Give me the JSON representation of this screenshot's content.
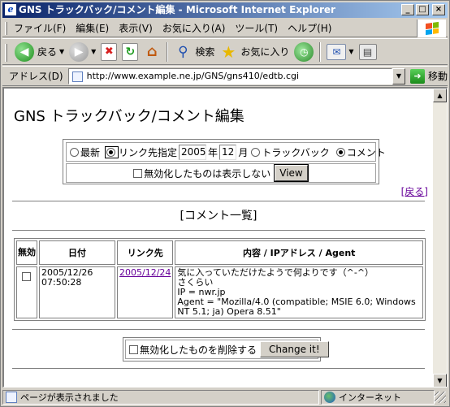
{
  "window": {
    "title": "GNS トラックバック/コメント編集 - Microsoft Internet Explorer",
    "minimize": "_",
    "maximize": "□",
    "close": "×"
  },
  "menubar": {
    "items": [
      "ファイル(F)",
      "編集(E)",
      "表示(V)",
      "お気に入り(A)",
      "ツール(T)",
      "ヘルプ(H)"
    ]
  },
  "toolbar": {
    "back_label": "戻る",
    "search_label": "検索",
    "favorites_label": "お気に入り"
  },
  "address": {
    "label": "アドレス(D)",
    "url": "http://www.example.ne.jp/GNS/gns410/edtb.cgi",
    "go_label": "移動"
  },
  "page": {
    "title": "GNS トラックバック/コメント編集",
    "filter": {
      "radio_latest": "最新",
      "radio_link_date": "リンク先指定",
      "year_value": "2005",
      "year_unit": "年",
      "month_value": "12",
      "month_unit": "月",
      "radio_trackback": "トラックバック",
      "radio_comment": "コメント",
      "hide_disabled_label": "無効化したものは表示しない",
      "view_button": "View"
    },
    "back_link": "[戻る]",
    "section_heading": "[コメント一覧]",
    "table": {
      "headers": [
        "無効",
        "日付",
        "リンク先",
        "内容 / IPアドレス / Agent"
      ],
      "rows": [
        {
          "date": "2005/12/26",
          "time": "07:50:28",
          "link": "2005/12/24",
          "content_line1": "気に入っていただけたようで何よりです（^-^）",
          "content_line2": "さくらい",
          "content_line3": "IP = nwr.jp",
          "content_line4": "Agent = \"Mozilla/4.0 (compatible; MSIE 6.0; Windows NT 5.1; ja) Opera 8.51\""
        }
      ]
    },
    "delete_disabled_label": "無効化したものを削除する",
    "change_button": "Change it!"
  },
  "statusbar": {
    "status": "ページが表示されました",
    "zone": "インターネット"
  }
}
